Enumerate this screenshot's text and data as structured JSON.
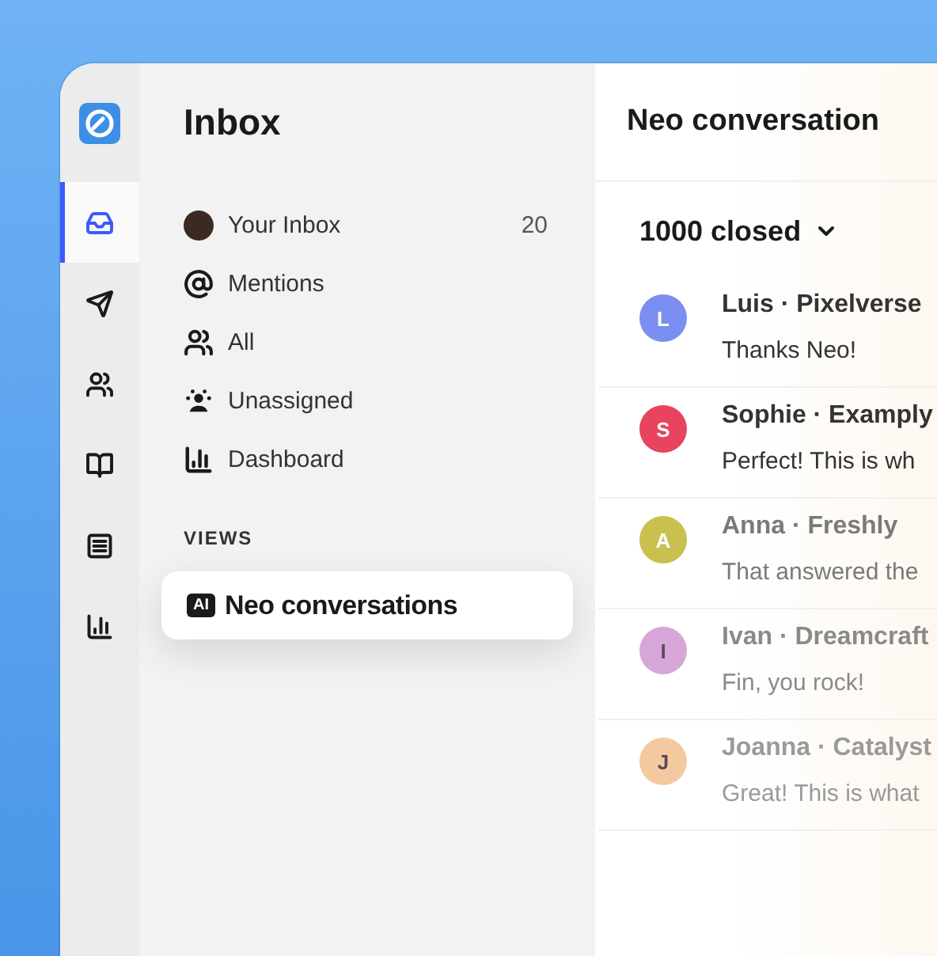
{
  "rail": {
    "items": [
      {
        "kind": "inbox",
        "selected": true
      },
      {
        "kind": "send",
        "selected": false
      },
      {
        "kind": "contacts",
        "selected": false
      },
      {
        "kind": "articles",
        "selected": false
      },
      {
        "kind": "messenger",
        "selected": false
      },
      {
        "kind": "reports",
        "selected": false
      }
    ]
  },
  "sidebar": {
    "title": "Inbox",
    "items": [
      {
        "kind": "avatar",
        "label": "Your Inbox",
        "count": "20"
      },
      {
        "kind": "mention",
        "label": "Mentions"
      },
      {
        "kind": "team",
        "label": "All"
      },
      {
        "kind": "unassigned",
        "label": "Unassigned"
      },
      {
        "kind": "chart",
        "label": "Dashboard"
      }
    ],
    "views_heading": "VIEWS",
    "views": [
      {
        "badge": "AI",
        "label": "Neo conversations",
        "selected": true
      }
    ]
  },
  "main": {
    "title": "Neo conversation",
    "filter": "1000 closed",
    "conversations": [
      {
        "initial": "L",
        "color": "#7b8ff0",
        "name": "Luis · Pixelverse",
        "message": "Thanks Neo!"
      },
      {
        "initial": "S",
        "color": "#e8435f",
        "name": "Sophie · Examply",
        "message": "Perfect! This is wh"
      },
      {
        "initial": "A",
        "color": "#c9c04f",
        "name": "Anna · Freshly",
        "message": "That answered the"
      },
      {
        "initial": "I",
        "color": "#d7a6d9",
        "name": "Ivan · Dreamcraft",
        "message": "Fin, you rock!"
      },
      {
        "initial": "J",
        "color": "#f5c9a0",
        "name": "Joanna · Catalyst",
        "message": "Great! This is what"
      }
    ]
  }
}
